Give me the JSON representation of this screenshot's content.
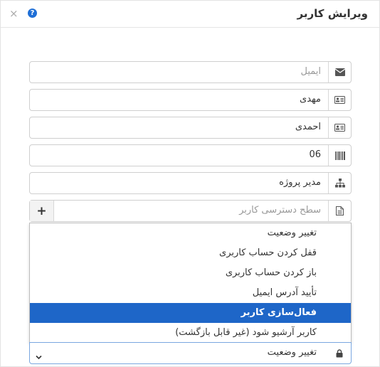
{
  "dialog": {
    "title": "ویرایش کاربر",
    "close_glyph": "×",
    "help_glyph": "?"
  },
  "fields": {
    "email": {
      "placeholder": "ایمیل",
      "icon": "envelope-icon"
    },
    "first_name": {
      "value": "مهدی",
      "icon": "id-card-icon"
    },
    "last_name": {
      "value": "احمدی",
      "icon": "id-card-icon"
    },
    "code": {
      "value": "06",
      "icon": "barcode-icon"
    },
    "role": {
      "value": "مدیر پروژه",
      "icon": "sitemap-icon"
    },
    "access_level": {
      "placeholder": "سطح دسترسی کاربر",
      "icon": "document-icon",
      "add_glyph": "+"
    }
  },
  "status_dropdown": {
    "options": [
      "تغییر وضعیت",
      "قفل کردن حساب کاربری",
      "باز کردن حساب کاربری",
      "تأیید آدرس ایمیل",
      "فعال‌سازی کاربر",
      "کاربر آرشیو شود (غیر قابل بازگشت)"
    ],
    "highlighted_index": 4,
    "selected_value": "تغییر وضعیت",
    "icon": "lock-icon"
  },
  "colors": {
    "highlight": "#1e66c8",
    "help_icon": "#1f6fd6"
  }
}
